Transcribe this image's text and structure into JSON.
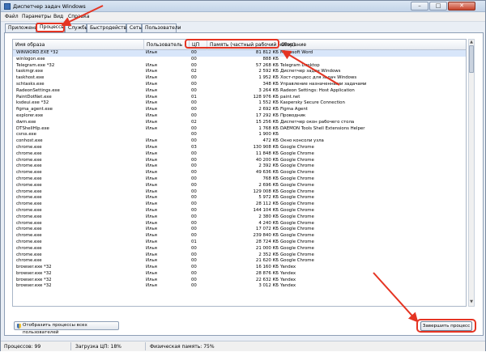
{
  "window": {
    "title": "Диспетчер задач Windows",
    "controls": [
      "–",
      "□",
      "✕"
    ]
  },
  "menu": [
    "Файл",
    "Параметры",
    "Вид",
    "Справка"
  ],
  "tabs": [
    {
      "label": "Приложения",
      "active": false
    },
    {
      "label": "Процессы",
      "active": true
    },
    {
      "label": "Службы",
      "active": false
    },
    {
      "label": "Быстродействие",
      "active": false
    },
    {
      "label": "Сеть",
      "active": false
    },
    {
      "label": "Пользователи",
      "active": false
    }
  ],
  "table": {
    "columns": [
      "Имя образа",
      "Пользователь",
      "ЦП",
      "Память (частный рабочий набор)",
      "Описание"
    ],
    "rows": [
      [
        "WINWORD.EXE *32",
        "Илья",
        "00",
        "81 812 КБ",
        "Microsoft Word"
      ],
      [
        "winlogon.exe",
        "",
        "00",
        "888 КБ",
        ""
      ],
      [
        "Telegram.exe *32",
        "Илья",
        "00",
        "57 268 КБ",
        "Telegram Desktop"
      ],
      [
        "taskmgr.exe",
        "Илья",
        "02",
        "2 592 КБ",
        "Диспетчер задач Windows"
      ],
      [
        "taskhost.exe",
        "Илья",
        "00",
        "1 952 КБ",
        "Хост-процесс для задач Windows"
      ],
      [
        "schtasks.exe",
        "Илья",
        "00",
        "348 КБ",
        "Управление назначенными задачами"
      ],
      [
        "RadeonSettings.exe",
        "Илья",
        "00",
        "3 264 КБ",
        "Radeon Settings: Host Application"
      ],
      [
        "PaintDotNet.exe",
        "Илья",
        "01",
        "128 976 КБ",
        "paint.net"
      ],
      [
        "ksdeui.exe *32",
        "Илья",
        "00",
        "1 552 КБ",
        "Kaspersky Secure Connection"
      ],
      [
        "figma_agent.exe",
        "Илья",
        "00",
        "2 692 КБ",
        "Figma Agent"
      ],
      [
        "explorer.exe",
        "Илья",
        "00",
        "17 292 КБ",
        "Проводник"
      ],
      [
        "dwm.exe",
        "Илья",
        "02",
        "15 256 КБ",
        "Диспетчер окон рабочего стола"
      ],
      [
        "DTShellHlp.exe",
        "Илья",
        "00",
        "1 768 КБ",
        "DAEMON Tools Shell Extensions Helper"
      ],
      [
        "csrss.exe",
        "",
        "00",
        "1 900 КБ",
        ""
      ],
      [
        "conhost.exe",
        "Илья",
        "00",
        "472 КБ",
        "Окно консоли узла"
      ],
      [
        "chrome.exe",
        "Илья",
        "03",
        "130 908 КБ",
        "Google Chrome"
      ],
      [
        "chrome.exe",
        "Илья",
        "00",
        "11 848 КБ",
        "Google Chrome"
      ],
      [
        "chrome.exe",
        "Илья",
        "00",
        "40 200 КБ",
        "Google Chrome"
      ],
      [
        "chrome.exe",
        "Илья",
        "00",
        "2 392 КБ",
        "Google Chrome"
      ],
      [
        "chrome.exe",
        "Илья",
        "00",
        "49 636 КБ",
        "Google Chrome"
      ],
      [
        "chrome.exe",
        "Илья",
        "00",
        "768 КБ",
        "Google Chrome"
      ],
      [
        "chrome.exe",
        "Илья",
        "00",
        "2 696 КБ",
        "Google Chrome"
      ],
      [
        "chrome.exe",
        "Илья",
        "00",
        "129 008 КБ",
        "Google Chrome"
      ],
      [
        "chrome.exe",
        "Илья",
        "00",
        "5 972 КБ",
        "Google Chrome"
      ],
      [
        "chrome.exe",
        "Илья",
        "00",
        "28 112 КБ",
        "Google Chrome"
      ],
      [
        "chrome.exe",
        "Илья",
        "00",
        "144 104 КБ",
        "Google Chrome"
      ],
      [
        "chrome.exe",
        "Илья",
        "00",
        "2 380 КБ",
        "Google Chrome"
      ],
      [
        "chrome.exe",
        "Илья",
        "00",
        "4 240 КБ",
        "Google Chrome"
      ],
      [
        "chrome.exe",
        "Илья",
        "00",
        "17 072 КБ",
        "Google Chrome"
      ],
      [
        "chrome.exe",
        "Илья",
        "00",
        "239 840 КБ",
        "Google Chrome"
      ],
      [
        "chrome.exe",
        "Илья",
        "01",
        "28 724 КБ",
        "Google Chrome"
      ],
      [
        "chrome.exe",
        "Илья",
        "00",
        "21 000 КБ",
        "Google Chrome"
      ],
      [
        "chrome.exe",
        "Илья",
        "00",
        "2 352 КБ",
        "Google Chrome"
      ],
      [
        "chrome.exe",
        "Илья",
        "00",
        "21 620 КБ",
        "Google Chrome"
      ],
      [
        "browser.exe *32",
        "Илья",
        "00",
        "16 160 КБ",
        "Yandex"
      ],
      [
        "browser.exe *32",
        "Илья",
        "00",
        "28 876 КБ",
        "Yandex"
      ],
      [
        "browser.exe *32",
        "Илья",
        "00",
        "22 632 КБ",
        "Yandex"
      ],
      [
        "browser.exe *32",
        "Илья",
        "00",
        "3 012 КБ",
        "Yandex"
      ]
    ]
  },
  "buttons": {
    "show_all": "Отобразить процессы всех пользователей",
    "end_process": "Завершить процесс"
  },
  "status": {
    "processes": "Процессов: 99",
    "cpu": "Загрузка ЦП: 18%",
    "memory": "Физическая память: 75%"
  },
  "scrollbar": {
    "position": 0.0
  },
  "annotation_color": "#e53422"
}
